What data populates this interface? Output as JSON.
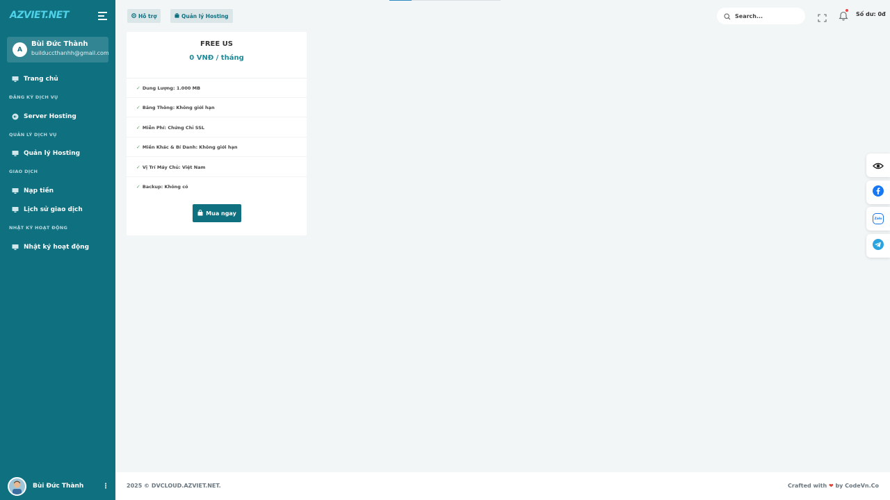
{
  "sidebar": {
    "logo": "AZVIET.NET",
    "user": {
      "initial": "A",
      "name": "Bùi Đức Thành",
      "email": "builduccthanhh@gmail.com"
    },
    "items": [
      {
        "label": "Trang chủ",
        "icon": "monitor-icon"
      },
      {
        "section": "ĐĂNG KÝ DỊCH VỤ"
      },
      {
        "label": "Server Hosting",
        "icon": "arrow-circle-icon"
      },
      {
        "section": "QUẢN LÝ DỊCH VỤ"
      },
      {
        "label": "Quản lý Hosting",
        "icon": "monitor-icon"
      },
      {
        "section": "GIAO DỊCH"
      },
      {
        "label": "Nạp tiền",
        "icon": "monitor-icon"
      },
      {
        "label": "Lịch sử giao dịch",
        "icon": "monitor-icon"
      },
      {
        "section": "NHẬT KÝ HOẠT ĐỘNG"
      },
      {
        "label": "Nhật ký hoạt động",
        "icon": "monitor-icon"
      }
    ],
    "footer_user": {
      "name": "Bùi Đức Thành",
      "menu": "⋮"
    }
  },
  "header": {
    "support_label": "Hỗ trợ",
    "hosting_label": "Quản lý Hosting",
    "search_placeholder": "Search...",
    "balance": "Số dư: 0đ"
  },
  "plan": {
    "name": "FREE US",
    "price": "0 VNĐ / tháng",
    "features": [
      "Dung Lượng: 1.000 MB",
      "Băng Thông: Không giới hạn",
      "Miễn Phí: Chứng Chỉ SSL",
      "Miền Khác & Bí Danh: Không giới hạn",
      "Vị Trí Máy Chủ: Việt Nam",
      "Backup: Không có"
    ],
    "buy_label": "Mua ngay"
  },
  "footer": {
    "copyright": "2025 © DVCLOUD.AZVIET.NET.",
    "crafted_prefix": "Crafted with",
    "crafted_heart": "❤",
    "crafted_suffix": "by CodeVn.Co"
  },
  "floating": {
    "zalo_label": "Zalo"
  },
  "colors": {
    "sidebar_bg": "#0f7080",
    "accent": "#0f7080",
    "price": "#1d8a9a",
    "logo": "#4fd1e8",
    "page_bg": "#f2f6f7",
    "facebook": "#1877f2",
    "telegram": "#2aa3df"
  }
}
